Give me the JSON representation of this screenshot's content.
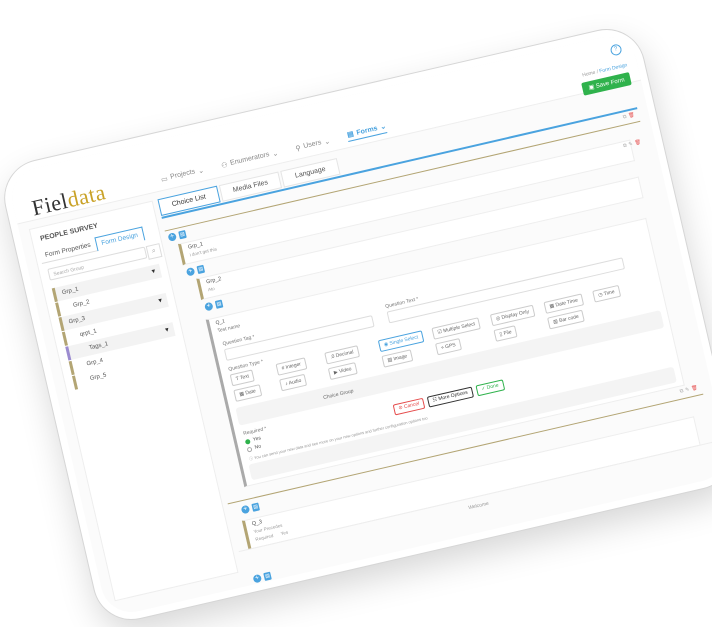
{
  "app": {
    "logo_main": "Fiel",
    "logo_accent": "data",
    "help_icon": "help-circle-icon",
    "colors": {
      "accent": "#4aa3df",
      "success": "#2fb24c",
      "gold": "#b3a574",
      "danger": "#e54b4b"
    }
  },
  "nav": {
    "projects": "Projects",
    "enumerators": "Enumerators",
    "users": "Users",
    "forms": "Forms"
  },
  "breadcrumb": {
    "home": "Home",
    "sep": "/",
    "current": "Form Design"
  },
  "header": {
    "save_label": "Save Form"
  },
  "sidebar": {
    "survey_title": "PEOPLE SURVEY",
    "tab_properties": "Form Properties",
    "tab_design": "Form Design",
    "search_placeholder": "Search Group",
    "tree": [
      {
        "label": "Grp_1"
      },
      {
        "label": "Grp_2"
      },
      {
        "label": "Grp_3"
      },
      {
        "label": "qrpt_1"
      },
      {
        "label": "Tags_1"
      },
      {
        "label": "Grp_4"
      },
      {
        "label": "Grp_5"
      }
    ]
  },
  "main": {
    "tabs": {
      "choice": "Choice List",
      "media": "Media Files",
      "language": "Language"
    },
    "group1": {
      "name": "Grp_1",
      "desc": "i don't get this"
    },
    "group2": {
      "name": "Grp_2",
      "desc": "Ato"
    },
    "question": {
      "name": "Q_1",
      "desc": "Test name",
      "tag_label": "Question Tag *",
      "text_label": "Question Text *",
      "type_label": "Question Type *",
      "types": {
        "text": "Text",
        "integer": "Integer",
        "decimal": "Decimal",
        "single": "Single Select",
        "multiple": "Multiple Select",
        "display": "Display Only",
        "datetime": "Date Time",
        "time": "Time",
        "date": "Date",
        "audio": "Audio",
        "video": "Video",
        "image": "Image",
        "gps": "GPS",
        "file": "File",
        "barcode": "Bar code"
      },
      "choice_group": "Choice Group",
      "required_label": "Required *",
      "yes": "Yes",
      "no": "No",
      "info": "You can send your new data and see more on your new options and further configuration options too",
      "cancel": "Cancel",
      "more": "More Options",
      "done": "Done"
    },
    "footer": "Welcome",
    "group3": {
      "name": "Q_3",
      "desc": "Your Precedes",
      "req_label": "Required",
      "req_value": "Yes"
    },
    "group4": {
      "name": "Grp_2",
      "desc": "New Group"
    }
  }
}
